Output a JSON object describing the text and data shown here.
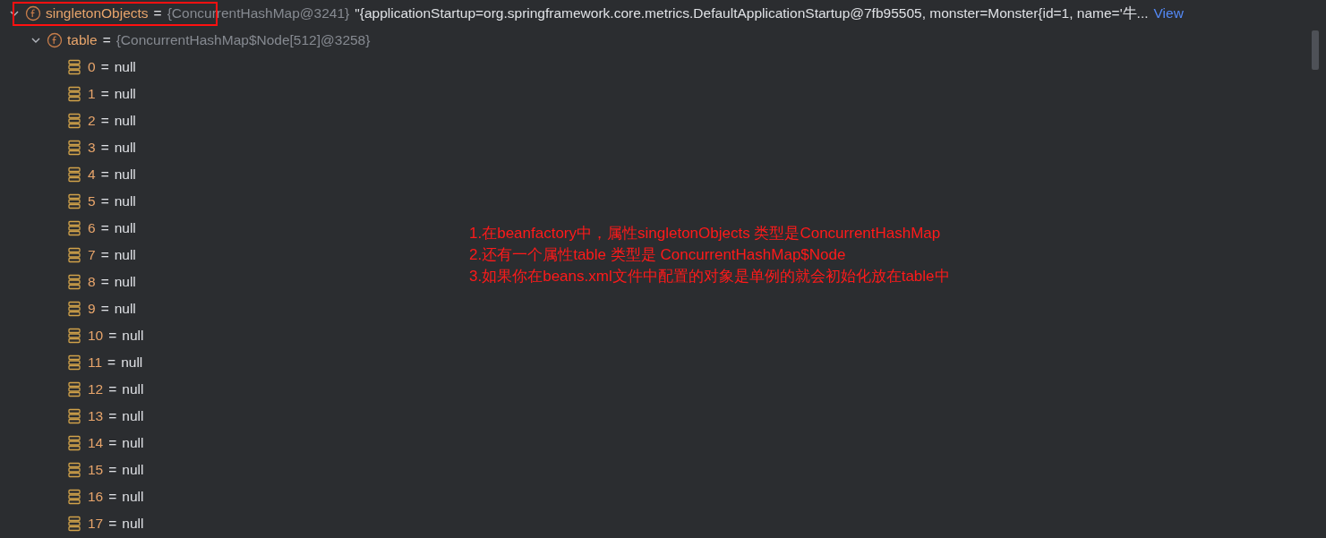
{
  "tree": [
    {
      "kind": "field",
      "name": "singletonObjects",
      "sep": "=",
      "type_text": "{ConcurrentHashMap@3241}",
      "value_text": "\"{applicationStartup=org.springframework.core.metrics.DefaultApplicationStartup@7fb95505, monster=Monster{id=1, name='牛...",
      "link": "View",
      "expanded": true,
      "highlighted": true,
      "children": [
        {
          "kind": "field",
          "name": "table",
          "sep": "=",
          "type_text": "{ConcurrentHashMap$Node[512]@3258}",
          "expanded": true,
          "children": [
            {
              "kind": "element",
              "name": "0",
              "sep": "=",
              "value_text": "null"
            },
            {
              "kind": "element",
              "name": "1",
              "sep": "=",
              "value_text": "null"
            },
            {
              "kind": "element",
              "name": "2",
              "sep": "=",
              "value_text": "null"
            },
            {
              "kind": "element",
              "name": "3",
              "sep": "=",
              "value_text": "null"
            },
            {
              "kind": "element",
              "name": "4",
              "sep": "=",
              "value_text": "null"
            },
            {
              "kind": "element",
              "name": "5",
              "sep": "=",
              "value_text": "null"
            },
            {
              "kind": "element",
              "name": "6",
              "sep": "=",
              "value_text": "null"
            },
            {
              "kind": "element",
              "name": "7",
              "sep": "=",
              "value_text": "null"
            },
            {
              "kind": "element",
              "name": "8",
              "sep": "=",
              "value_text": "null"
            },
            {
              "kind": "element",
              "name": "9",
              "sep": "=",
              "value_text": "null"
            },
            {
              "kind": "element",
              "name": "10",
              "sep": "=",
              "value_text": "null"
            },
            {
              "kind": "element",
              "name": "11",
              "sep": "=",
              "value_text": "null"
            },
            {
              "kind": "element",
              "name": "12",
              "sep": "=",
              "value_text": "null"
            },
            {
              "kind": "element",
              "name": "13",
              "sep": "=",
              "value_text": "null"
            },
            {
              "kind": "element",
              "name": "14",
              "sep": "=",
              "value_text": "null"
            },
            {
              "kind": "element",
              "name": "15",
              "sep": "=",
              "value_text": "null"
            },
            {
              "kind": "element",
              "name": "16",
              "sep": "=",
              "value_text": "null"
            },
            {
              "kind": "element",
              "name": "17",
              "sep": "=",
              "value_text": "null"
            }
          ]
        }
      ]
    }
  ],
  "annotation": {
    "lines": [
      "1.在beanfactory中，属性singletonObjects 类型是ConcurrentHashMap",
      "2.还有一个属性table 类型是 ConcurrentHashMap$Node",
      "3.如果你在beans.xml文件中配置的对象是单例的就会初始化放在table中"
    ]
  }
}
